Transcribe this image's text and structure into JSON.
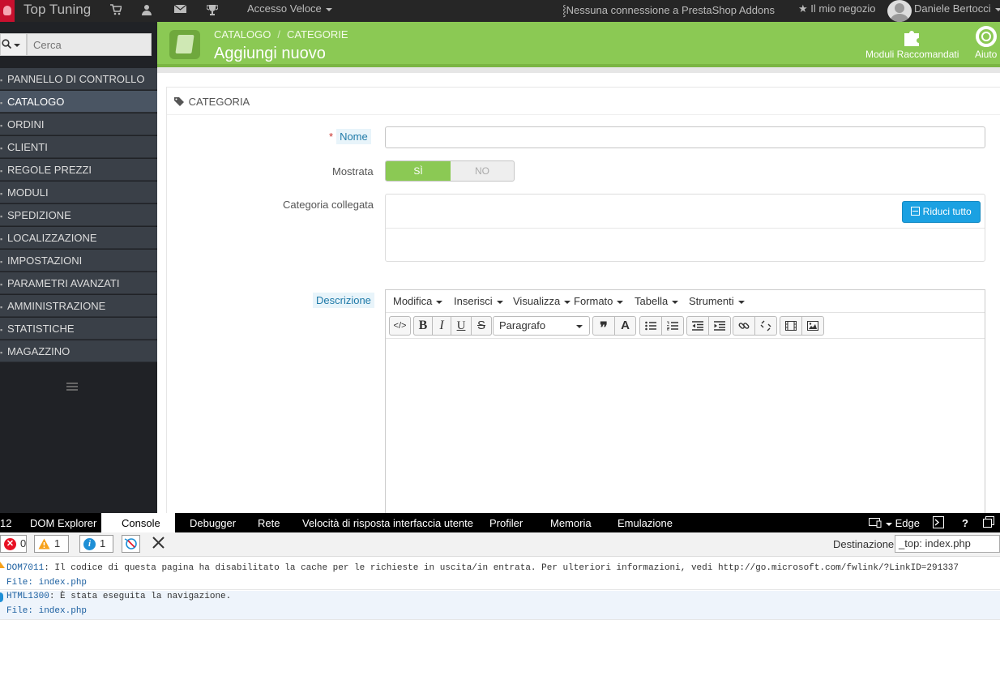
{
  "topbar": {
    "brand": "Top Tuning",
    "quick_access": "Accesso Veloce",
    "addons_status": "Nessuna connessione a PrestaShop Addons",
    "my_shop": "Il mio negozio",
    "user": "Daniele Bertocci"
  },
  "sidebar": {
    "search_placeholder": "Cerca",
    "items": [
      {
        "label": "PANNELLO DI CONTROLLO"
      },
      {
        "label": "CATALOGO"
      },
      {
        "label": "ORDINI"
      },
      {
        "label": "CLIENTI"
      },
      {
        "label": "REGOLE PREZZI"
      },
      {
        "label": "MODULI"
      },
      {
        "label": "SPEDIZIONE"
      },
      {
        "label": "LOCALIZZAZIONE"
      },
      {
        "label": "IMPOSTAZIONI"
      },
      {
        "label": "PARAMETRI AVANZATI"
      },
      {
        "label": "AMMINISTRAZIONE"
      },
      {
        "label": "STATISTICHE"
      },
      {
        "label": "MAGAZZINO"
      }
    ],
    "active_index": 1
  },
  "header": {
    "crumb_1": "CATALOGO",
    "crumb_2": "CATEGORIE",
    "title": "Aggiungi nuovo",
    "recommended_modules": "Moduli Raccomandati",
    "help": "Aiuto"
  },
  "form": {
    "panel_title": "CATEGORIA",
    "name_label": "Nome",
    "name_value": "",
    "shown_label": "Mostrata",
    "switch_yes": "SÌ",
    "switch_no": "NO",
    "shown_value": "SÌ",
    "parent_label": "Categoria collegata",
    "collapse_all": "Riduci tutto",
    "description_label": "Descrizione"
  },
  "editor": {
    "menus": [
      "Modifica",
      "Inserisci",
      "Visualizza",
      "Formato",
      "Tabella",
      "Strumenti"
    ],
    "format_value": "Paragrafo"
  },
  "devtools": {
    "count": "12",
    "tabs": [
      "DOM Explorer",
      "Console",
      "Debugger",
      "Rete",
      "Velocità di risposta interfaccia utente",
      "Profiler",
      "Memoria",
      "Emulazione"
    ],
    "active_tab": "Console",
    "browser_mode": "Edge",
    "errors": "0",
    "warnings": "1",
    "infos": "1",
    "destination_label": "Destinazione:",
    "destination_value": "_top: index.php",
    "messages": [
      {
        "code": "DOM7011",
        "text": ": Il codice di questa pagina ha disabilitato la cache per le richieste in uscita/in entrata. Per ulteriori informazioni, vedi http://go.microsoft.com/fwlink/?LinkID=291337",
        "file": "File: index.php"
      },
      {
        "code": "HTML1300",
        "text": ": È stata eseguita la navigazione.",
        "file": "File: index.php"
      }
    ]
  }
}
